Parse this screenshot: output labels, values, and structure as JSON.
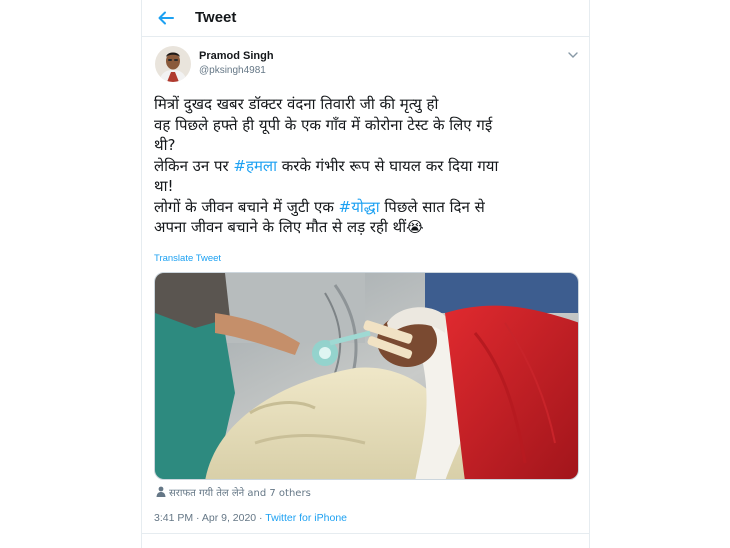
{
  "header": {
    "title": "Tweet"
  },
  "author": {
    "name": "Pramod Singh",
    "handle": "@pksingh4981"
  },
  "tweet": {
    "lines": [
      "मित्रों दुखद खबर डॉक्टर वंदना तिवारी जी की मृत्यु हो",
      "वह पिछले हफ्ते ही यूपी के एक गाँव में कोरोना टेस्ट के लिए गई",
      "थी?",
      "था!",
      "अपना जीवन बचाने के लिए मौत से लड़ रही थीं😭"
    ],
    "line4_before": "लेकिन उन पर ",
    "line4_hashtag": "#हमला",
    "line4_after": " करके गंभीर रूप से घायल कर दिया गया",
    "line6_before": "लोगों के जीवन बचाने में जुटी एक ",
    "line6_hashtag": "#योद्धा",
    "line6_after": " पिछले सात दिन से"
  },
  "translate_label": "Translate Tweet",
  "tagged": {
    "name": "सराफत गयी तेल लेने",
    "others": " and 7 others"
  },
  "meta": {
    "time": "3:41 PM · Apr 9, 2020 · ",
    "source": "Twitter for iPhone"
  },
  "colors": {
    "accent": "#1da1f2",
    "muted": "#657786",
    "text": "#14171a",
    "border": "#e6ecf0"
  },
  "icons": {
    "back": "arrow-left-icon",
    "caret": "chevron-down-icon",
    "tag": "person-icon"
  }
}
